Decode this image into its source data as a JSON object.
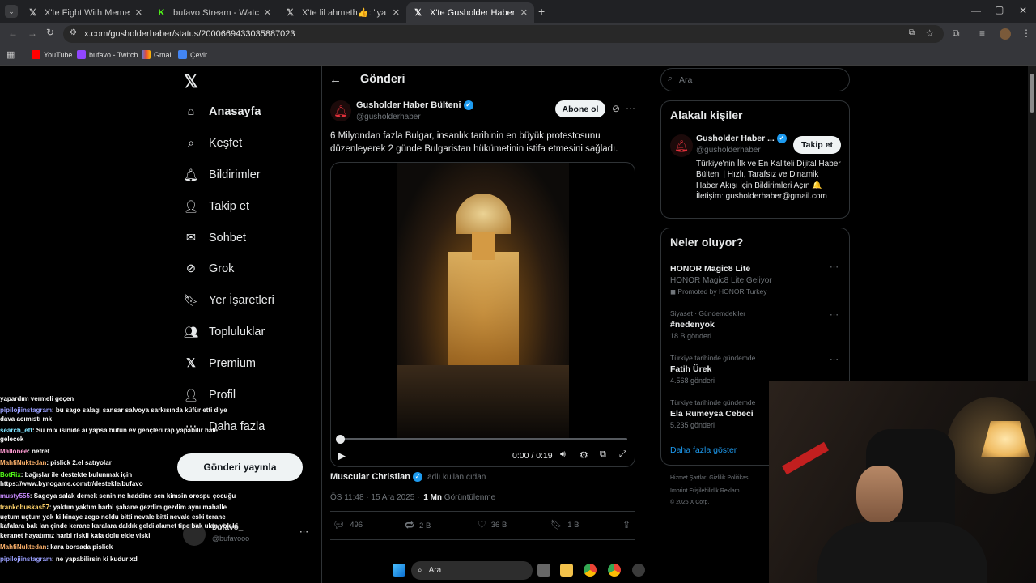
{
  "browser": {
    "tabs": [
      {
        "title": "X'te Fight With Memes: \"Fargo…",
        "active": false
      },
      {
        "title": "bufavo Stream - Watch Live on…",
        "active": false
      },
      {
        "title": "X'te lil ahmeth👍: \"ya @wegh…",
        "active": false
      },
      {
        "title": "X'te Gusholder Haber Bülteni: \"…",
        "active": true
      }
    ],
    "url": "x.com/gusholderhaber/status/2000669433035887023",
    "bookmarks": [
      "YouTube",
      "bufavo - Twitch",
      "Gmail",
      "Çevir"
    ]
  },
  "nav": {
    "items": [
      "Anasayfa",
      "Keşfet",
      "Bildirimler",
      "Takip et",
      "Sohbet",
      "Grok",
      "Yer İşaretleri",
      "Topluluklar",
      "Premium",
      "Profil",
      "Daha fazla"
    ],
    "post_button": "Gönderi yayınla",
    "account_name": "bufavo_",
    "account_handle": "@bufavooo"
  },
  "post": {
    "header": "Gönderi",
    "author": "Gusholder Haber Bülteni",
    "handle": "@gusholderhaber",
    "subscribe": "Abone ol",
    "text": "6 Milyondan fazla Bulgar, insanlık tarihinin en büyük protestosunu düzenleyerek 2 günde Bulgaristan hükümetinin istifa etmesini sağladı.",
    "video_time": "0:00 / 0:19",
    "video_progress": 0.0,
    "credit_name": "Muscular Christian",
    "credit_suffix": "adlı kullanıcıdan",
    "meta_time": "ÖS 11:48 · 15 Ara 2025 ·",
    "views_value": "1 Mn",
    "views_label": "Görüntülenme",
    "replies": "496",
    "reposts": "2 B",
    "likes": "36 B",
    "bookmarks": "1 B"
  },
  "right": {
    "search_placeholder": "Ara",
    "related_title": "Alakalı kişiler",
    "related_name": "Gusholder Haber ...",
    "related_handle": "@gusholderhaber",
    "follow": "Takip et",
    "related_bio": "Türkiye'nin İlk ve En Kaliteli Dijital Haber Bülteni | Hızlı, Tarafsız ve Dinamik Haber Akışı için Bildirimleri Açın 🔔 İletişim: gusholderhaber@gmail.com",
    "trends_title": "Neler oluyor?",
    "trends": [
      {
        "context": "",
        "name": "HONOR Magic8 Lite",
        "sub": "HONOR Magic8 Lite Geliyor",
        "count": "Promoted by HONOR Turkey"
      },
      {
        "context": "Siyaset · Gündemdekiler",
        "name": "#nedenyok",
        "sub": "",
        "count": "18 B gönderi"
      },
      {
        "context": "Türkiye tarihinde gündemde",
        "name": "Fatih Ürek",
        "sub": "",
        "count": "4.568 gönderi"
      },
      {
        "context": "Türkiye tarihinde gündemde",
        "name": "Ela Rumeysa Cebeci",
        "sub": "",
        "count": "5.235 gönderi"
      }
    ],
    "show_more": "Daha fazla göster",
    "footer_line1": "Hizmet Şartları   Gizlilik Politikası",
    "footer_line2": "Imprint   Erişilebilirlik   Reklam",
    "footer_line3": "© 2025 X Corp."
  },
  "chat": [
    {
      "user": "",
      "msg": "yapardım vermeli geçen"
    },
    {
      "user": "pipilojiinstagram",
      "msg": ": bu sago salagı sansar salvoya sarkısında küfür etti diye dava acımıstı mk"
    },
    {
      "user": "search_ett",
      "msg": ": Su mix isinide ai yapsa butun ev gençleri rap yapabilir hale gelecek"
    },
    {
      "user": "Mallonee",
      "msg": ": nefret"
    },
    {
      "user": "MahfiNuktedan",
      "msg": ": pislick 2.el satıyolar"
    },
    {
      "user": "BotRix",
      "msg": ": bağışlar ile destekte bulunmak için https://www.bynogame.com/tr/destekle/bufavo"
    },
    {
      "user": "musty555",
      "msg": ": Sagoya salak demek senin ne haddine sen kimsin orospu çocuğu"
    },
    {
      "user": "trankobuskas57",
      "msg": ": yaktım yaktım harbi şahane gezdim gezdim aynı mahalle uçtum uçtum yok ki kinaye zego noldu bitti nevale bitti nevale eski terane kafalara bak lan çinde kerane karalara daldık geldi alamet tipe bak ulan yok ki keranet hayatımız harbi riskli kafa dolu elde viski"
    },
    {
      "user": "MahfiNuktedan",
      "msg": ": kara borsada pislick"
    },
    {
      "user": "pipilojiinstagram",
      "msg": ": ne yapabilirsin ki kudur xd"
    }
  ],
  "taskbar": {
    "search": "Ara"
  }
}
